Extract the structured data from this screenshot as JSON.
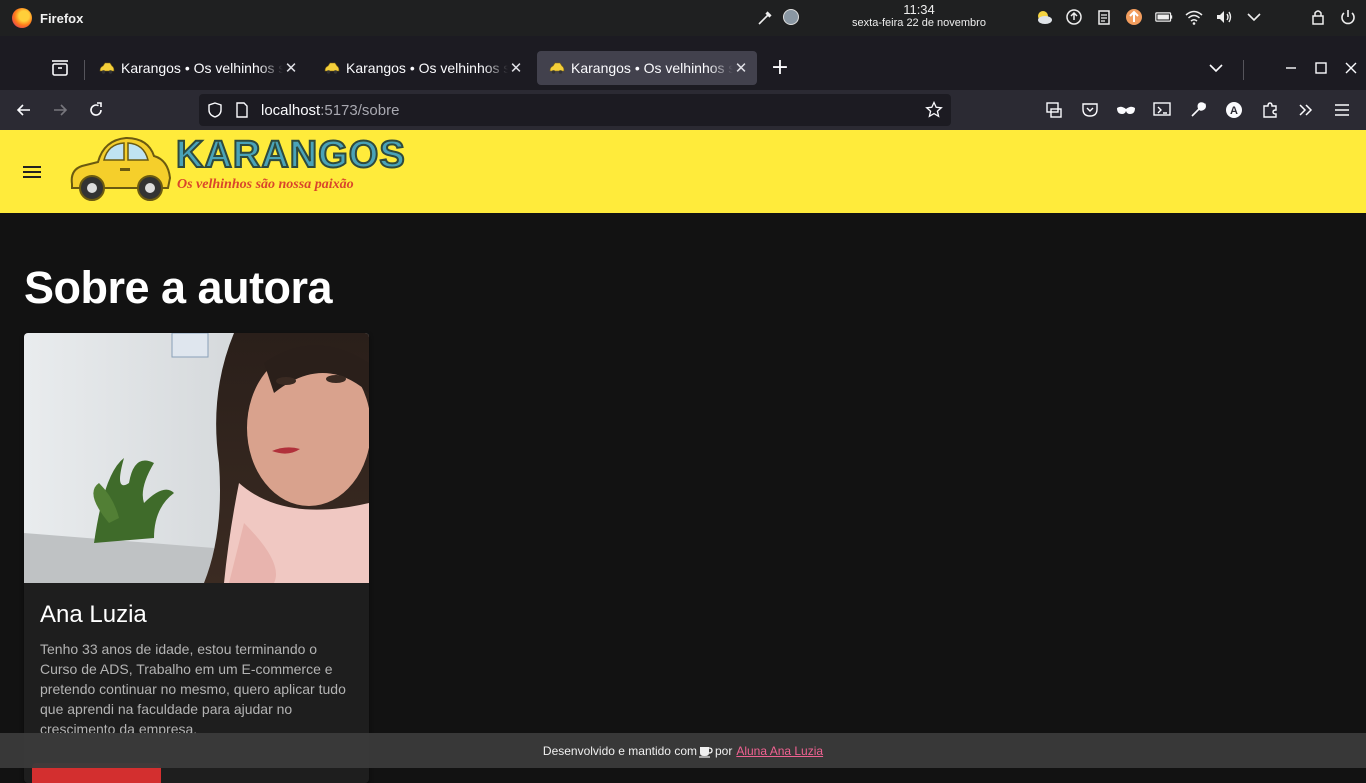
{
  "system": {
    "app_name": "Firefox",
    "time": "11:34",
    "date": "sexta-feira 22 de novembro"
  },
  "tabs": [
    {
      "title": "Karangos • Os velhinhos são nossa paixão",
      "active": false
    },
    {
      "title": "Karangos • Os velhinhos são nossa paixão",
      "active": false
    },
    {
      "title": "Karangos • Os velhinhos são nossa paixão",
      "active": true
    }
  ],
  "urlbar": {
    "host": "localhost",
    "path": ":5173/sobre"
  },
  "app": {
    "brand": "KARANGOS",
    "tagline": "Os velhinhos são nossa paixão",
    "header_color": "#ffeb3b"
  },
  "page": {
    "title": "Sobre a autora"
  },
  "card": {
    "name": "Ana Luzia",
    "bio": "Tenho 33 anos de idade, estou terminando o Curso de ADS, Trabalho em um E-commerce e pretendo continuar no mesmo, quero aplicar tudo que aprendi na faculdade para ajudar no crescimento da empresa."
  },
  "footer": {
    "text_before": "Desenvolvido e mantido com",
    "text_after": "por",
    "link_label": "Aluna Ana Luzia",
    "link_color": "#f06292"
  }
}
